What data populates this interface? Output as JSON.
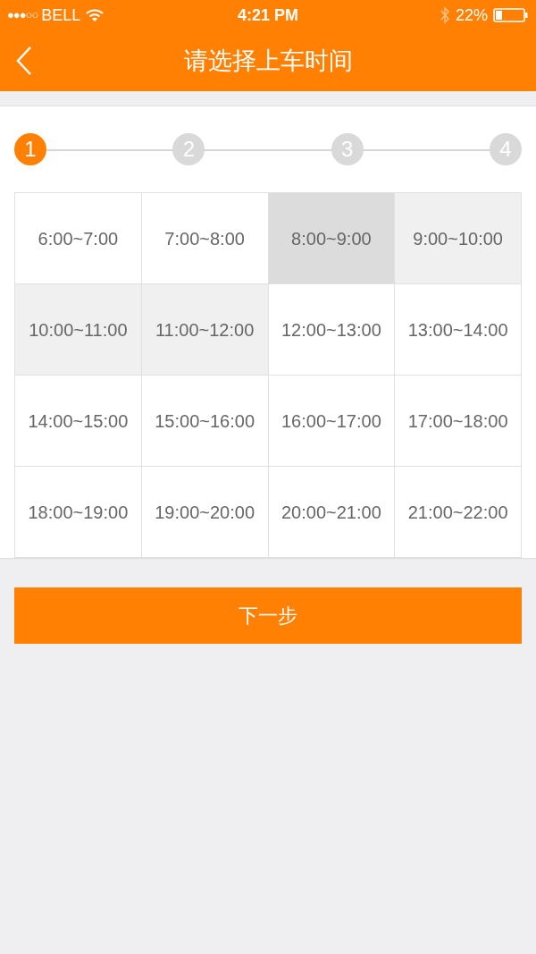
{
  "status_bar": {
    "signal": "●●●○○",
    "carrier": "BELL",
    "time": "4:21 PM",
    "battery": "22%"
  },
  "nav": {
    "title": "请选择上车时间"
  },
  "steps": [
    {
      "label": "1",
      "selected": true
    },
    {
      "label": "2",
      "selected": false
    },
    {
      "label": "3",
      "selected": false
    },
    {
      "label": "4",
      "selected": false
    }
  ],
  "time_slots": [
    {
      "label": "6:00~7:00",
      "selected": false,
      "highlighted": false
    },
    {
      "label": "7:00~8:00",
      "selected": false,
      "highlighted": false
    },
    {
      "label": "8:00~9:00",
      "selected": true,
      "highlighted": false
    },
    {
      "label": "9:00~10:00",
      "selected": false,
      "highlighted": true
    },
    {
      "label": "10:00~11:00",
      "selected": false,
      "highlighted": true
    },
    {
      "label": "11:00~12:00",
      "selected": false,
      "highlighted": true
    },
    {
      "label": "12:00~13:00",
      "selected": false,
      "highlighted": false
    },
    {
      "label": "13:00~14:00",
      "selected": false,
      "highlighted": false
    },
    {
      "label": "14:00~15:00",
      "selected": false,
      "highlighted": false
    },
    {
      "label": "15:00~16:00",
      "selected": false,
      "highlighted": false
    },
    {
      "label": "16:00~17:00",
      "selected": false,
      "highlighted": false
    },
    {
      "label": "17:00~18:00",
      "selected": false,
      "highlighted": false
    },
    {
      "label": "18:00~19:00",
      "selected": false,
      "highlighted": false
    },
    {
      "label": "19:00~20:00",
      "selected": false,
      "highlighted": false
    },
    {
      "label": "20:00~21:00",
      "selected": false,
      "highlighted": false
    },
    {
      "label": "21:00~22:00",
      "selected": false,
      "highlighted": false
    }
  ],
  "next_button": "下一步"
}
